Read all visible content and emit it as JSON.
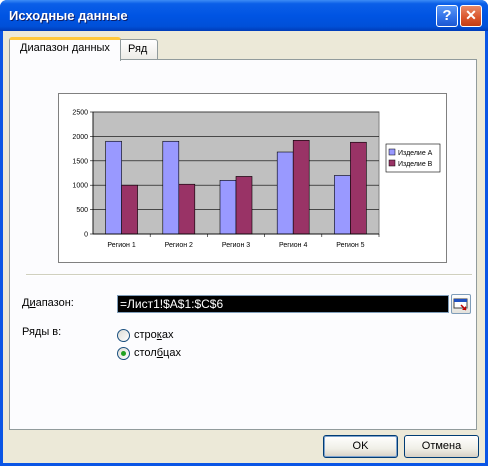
{
  "window": {
    "title": "Исходные данные",
    "help_glyph": "?",
    "close_glyph": "✕"
  },
  "tabs": [
    {
      "label": "Диапазон данных"
    },
    {
      "label": "Ряд"
    }
  ],
  "range": {
    "label_prefix": "Д",
    "label_underlined": "и",
    "label_suffix": "апазон:",
    "value": "=Лист1!$A$1:$C$6"
  },
  "series_in": {
    "label": "Ряды в:",
    "options": [
      {
        "prefix": "стро",
        "underlined": "к",
        "suffix": "ах",
        "checked": false
      },
      {
        "prefix": "стол",
        "underlined": "б",
        "suffix": "цах",
        "checked": true
      }
    ]
  },
  "buttons": {
    "ok": "OK",
    "cancel": "Отмена"
  },
  "colors": {
    "series_a": "#9999ff",
    "series_b": "#993366",
    "plot_bg": "#c0c0c0"
  },
  "chart_data": {
    "type": "bar",
    "categories": [
      "Регион 1",
      "Регион 2",
      "Регион 3",
      "Регион 4",
      "Регион 5"
    ],
    "series": [
      {
        "name": "Изделие А",
        "values": [
          1900,
          1900,
          1100,
          1680,
          1200
        ]
      },
      {
        "name": "Изделие В",
        "values": [
          1000,
          1020,
          1180,
          1920,
          1880
        ]
      }
    ],
    "yticks": [
      0,
      500,
      1000,
      1500,
      2000,
      2500
    ],
    "ylim": [
      0,
      2500
    ],
    "grid": true,
    "legend": "right"
  }
}
